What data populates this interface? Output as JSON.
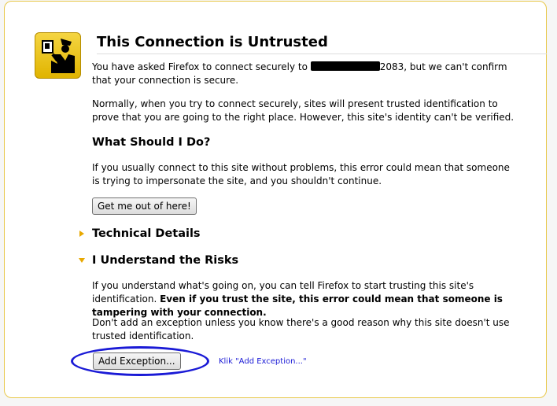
{
  "page": {
    "title": "This Connection is Untrusted",
    "intro_part1": "You have asked Firefox to connect securely to ",
    "intro_port": "2083",
    "intro_part2": ", but we can't confirm that your connection is secure.",
    "normal_text": "Normally, when you try to connect securely, sites will present trusted identification to prove that you are going to the right place. However, this site's identity can't be verified.",
    "what_heading": "What Should I Do?",
    "what_text": "If you usually connect to this site without problems, this error could mean that someone is trying to impersonate the site, and you shouldn't continue.",
    "get_out_label": "Get me out of here!",
    "tech_heading": "Technical Details",
    "risks_heading": "I Understand the Risks",
    "risks_text": "If you understand what's going on, you can tell Firefox to start trusting this site's identification. ",
    "risks_bold": "Even if you trust the site, this error could mean that someone is tampering with your connection.",
    "exception_text": "Don't add an exception unless you know there's a good reason why this site doesn't use trusted identification.",
    "add_exception_label": "Add Exception...",
    "annotation_note": "Klik \"Add Exception...\""
  },
  "icons": {
    "warning": "police-officer-id-icon",
    "expander_collapsed": "triangle-right-icon",
    "expander_expanded": "triangle-down-icon"
  },
  "colors": {
    "card_border": "#e8c84a",
    "icon_yellow": "#f0c800",
    "annotation_blue": "#1a1ad6"
  }
}
